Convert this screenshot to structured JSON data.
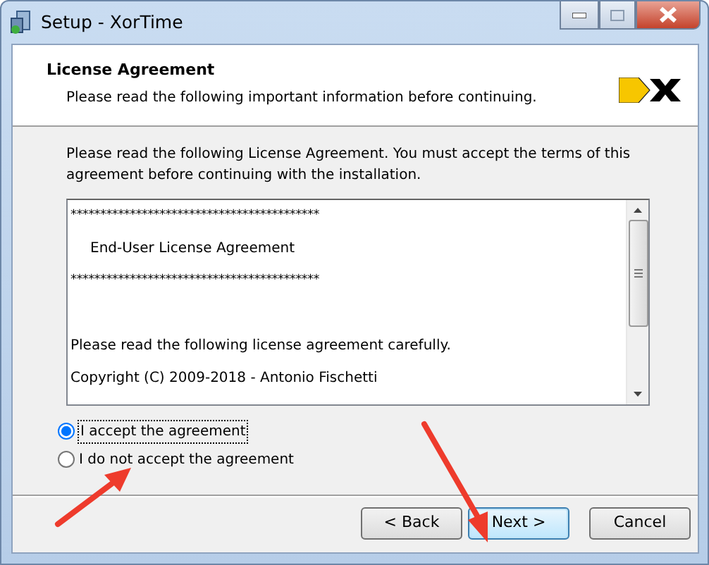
{
  "window": {
    "title": "Setup - XorTime"
  },
  "header": {
    "title": "License Agreement",
    "subtitle": "Please read the following important information before continuing."
  },
  "intro": "Please read the following License Agreement. You must accept the terms of this agreement before continuing with the installation.",
  "license_lines": [
    {
      "kind": "rule",
      "text": "******************************************"
    },
    {
      "kind": "heading",
      "text": "End-User License Agreement"
    },
    {
      "kind": "rule",
      "text": "******************************************"
    },
    {
      "kind": "text",
      "text": "Please read the following license agreement carefully."
    },
    {
      "kind": "text",
      "text": "Copyright (C) 2009-2018 - Antonio Fischetti"
    }
  ],
  "options": [
    {
      "label": "I accept the agreement",
      "selected": true
    },
    {
      "label": "I do not accept the agreement",
      "selected": false
    }
  ],
  "buttons": [
    {
      "label": "< Back",
      "default": false
    },
    {
      "label": "Next >",
      "default": true
    },
    {
      "label": "Cancel",
      "default": false
    }
  ]
}
